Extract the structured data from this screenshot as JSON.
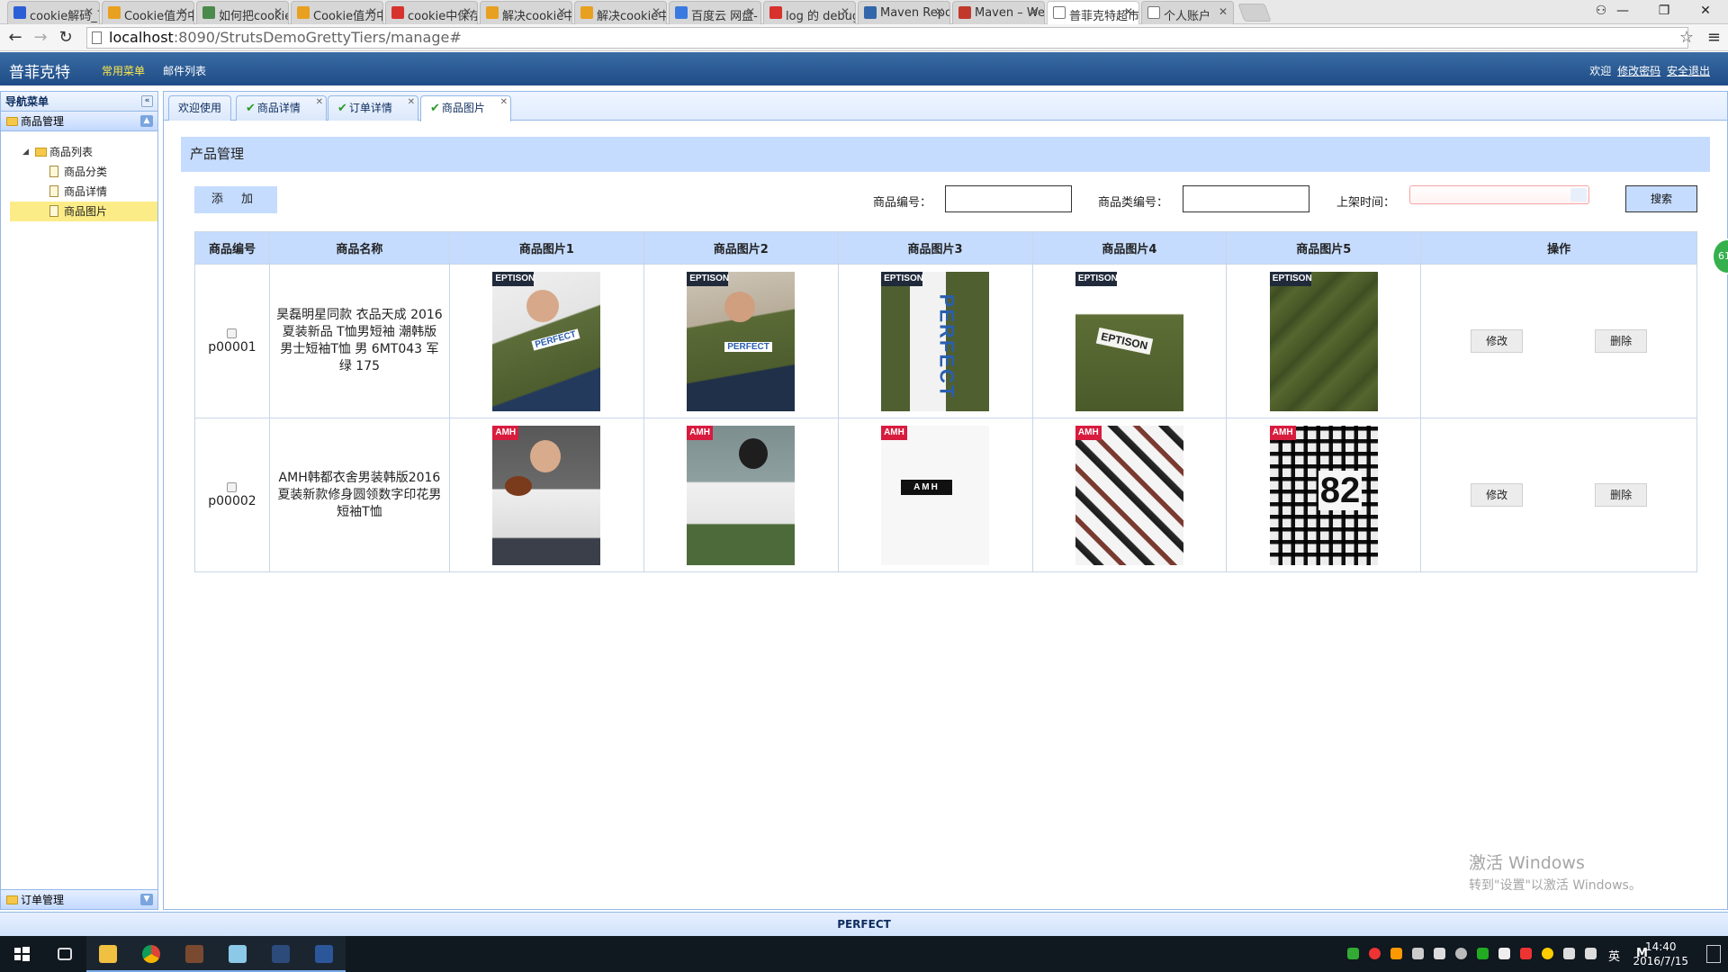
{
  "browser": {
    "tabs": [
      {
        "label": "cookie解码_百",
        "icon": "baidu-paw-icon",
        "color": "#2b5fd6"
      },
      {
        "label": "Cookie值为中",
        "icon": "site-colorful-icon",
        "color": "#e8a020"
      },
      {
        "label": "如何把cookie",
        "icon": "zhidao-icon",
        "color": "#4a8a4a"
      },
      {
        "label": "Cookie值为中",
        "icon": "site-colorful-icon",
        "color": "#e8a020"
      },
      {
        "label": "cookie中保存",
        "icon": "csdn-c-icon",
        "color": "#d7322e"
      },
      {
        "label": "解决cookie中",
        "icon": "site-colorful-icon",
        "color": "#e8a020"
      },
      {
        "label": "解决cookie中",
        "icon": "site-colorful-icon",
        "color": "#e8a020"
      },
      {
        "label": "百度云 网盘-",
        "icon": "baiduyun-icon",
        "color": "#3a7ae0"
      },
      {
        "label": "log 的 debug",
        "icon": "csdn-c-icon",
        "color": "#d7322e"
      },
      {
        "label": "Maven Repo",
        "icon": "mvn-icon",
        "color": "#3366aa"
      },
      {
        "label": "Maven – Wel",
        "icon": "maven-feather-icon",
        "color": "#c0392b"
      },
      {
        "label": "普菲克特超市",
        "icon": "page-icon",
        "color": "#ffffff"
      },
      {
        "label": "个人账户",
        "icon": "page-icon",
        "color": "#ffffff"
      }
    ],
    "active_tab": 11,
    "url_host": "localhost",
    "url_path": ":8090/StrutsDemoGrettyTiers/manage#"
  },
  "app": {
    "brand": "普菲克特",
    "nav_primary": "常用菜单",
    "nav_secondary": "邮件列表",
    "welcome": "欢迎",
    "change_password": "修改密码",
    "logout": "安全退出",
    "footer": "PERFECT"
  },
  "sidebar": {
    "title": "导航菜单",
    "sections": [
      {
        "label": "商品管理",
        "expanded": true
      },
      {
        "label": "订单管理",
        "expanded": false
      }
    ],
    "tree_root": "商品列表",
    "tree_items": [
      {
        "label": "商品分类",
        "selected": false
      },
      {
        "label": "商品详情",
        "selected": false
      },
      {
        "label": "商品图片",
        "selected": true
      }
    ]
  },
  "tabs": [
    {
      "label": "欢迎使用",
      "closable": false,
      "checked": false
    },
    {
      "label": "商品详情",
      "closable": true,
      "checked": true
    },
    {
      "label": "订单详情",
      "closable": true,
      "checked": true
    },
    {
      "label": "商品图片",
      "closable": true,
      "checked": true,
      "active": true
    }
  ],
  "panel": {
    "title": "产品管理",
    "add_label": "添 加",
    "filter_product_no": "商品编号：",
    "filter_category_no": "商品类编号：",
    "filter_shelf_time": "上架时间：",
    "search_label": "搜索"
  },
  "table": {
    "headers": [
      "商品编号",
      "商品名称",
      "商品图片1",
      "商品图片2",
      "商品图片3",
      "商品图片4",
      "商品图片5",
      "操作"
    ],
    "edit_label": "修改",
    "delete_label": "删除",
    "rows": [
      {
        "id": "p00001",
        "name": "昊磊明星同款 衣品天成 2016夏装新品 T恤男短袖 潮韩版男士短袖T恤 男 6MT043 军绿 175",
        "brand_tag": "EPTISON",
        "images": [
          "model-green-tee-photo",
          "model-sitting-green-tee-photo",
          "green-tee-print-closeup-photo",
          "green-tee-label-closeup-photo",
          "green-fabric-closeup-photo"
        ],
        "image_text": [
          "PERFECT",
          "PERFECT",
          "PERFECT",
          "EPTISON",
          ""
        ]
      },
      {
        "id": "p00002",
        "name": "AMH韩都衣舍男装韩版2016夏装新款修身圆领数字印花男短袖T恤",
        "brand_tag": "AMH",
        "images": [
          "model-with-football-photo",
          "model-at-railing-photo",
          "white-tee-collar-label-photo",
          "white-tee-print-closeup-photo",
          "black-white-pattern-print-photo"
        ],
        "image_text": [
          "",
          "",
          "AMH",
          "",
          "82"
        ]
      }
    ]
  },
  "watermark": {
    "line1": "激活 Windows",
    "line2": "转到\"设置\"以激活 Windows。"
  },
  "badge_text": "61",
  "taskbar": {
    "time": "14:40",
    "date": "2016/7/15",
    "ime": "英",
    "ime2": "M"
  }
}
